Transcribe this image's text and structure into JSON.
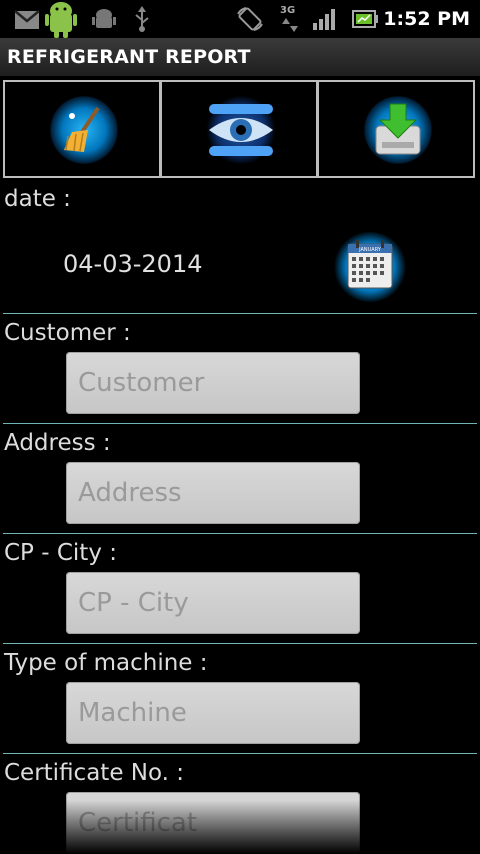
{
  "status_bar": {
    "time": "1:52 PM",
    "icons": [
      "gmail-icon",
      "android-debug-icon",
      "android-icon",
      "usb-icon",
      "rotate-icon",
      "3g-data-icon",
      "signal-icon",
      "battery-icon"
    ],
    "network_label": "3G"
  },
  "header": {
    "title": "REFRIGERANT REPORT"
  },
  "toolbar": {
    "buttons": [
      "broom-clear-icon",
      "eye-view-icon",
      "download-save-icon"
    ]
  },
  "form": {
    "date_label": "date :",
    "date_value": "04-03-2014",
    "calendar_icon_text": "JANUARY",
    "fields": [
      {
        "label": "Customer :",
        "placeholder": "Customer"
      },
      {
        "label": "Address :",
        "placeholder": "Address"
      },
      {
        "label": "CP - City :",
        "placeholder": "CP - City"
      },
      {
        "label": "Type of machine :",
        "placeholder": "Machine"
      },
      {
        "label": "Certificate No. :",
        "placeholder": "Certificat"
      }
    ]
  },
  "colors": {
    "background": "#000000",
    "divider": "#6fb3b3",
    "field_bg": "#d0d0d0",
    "orb": "#29b6f6"
  }
}
